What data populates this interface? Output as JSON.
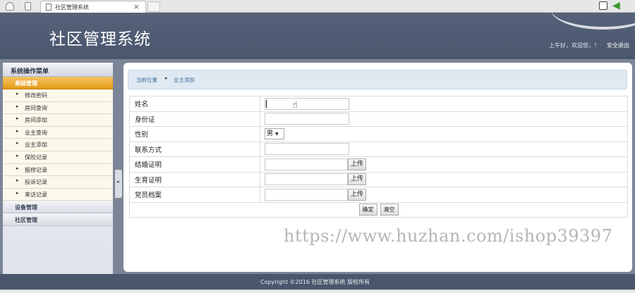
{
  "browser": {
    "tab_title": "社区管理系统",
    "tab_close": "×"
  },
  "header": {
    "brand": "社区管理系统",
    "greeting": "上午好，欢迎您，！",
    "logout": "安全退出"
  },
  "sidebar": {
    "title": "系统操作菜单",
    "groups": [
      {
        "label": "基础管理",
        "items": [
          "修改密码",
          "房间查询",
          "房间添加",
          "业主查询",
          "业主添加",
          "保险记录",
          "报修记录",
          "投诉记录",
          "来访记录"
        ]
      },
      {
        "label": "设备管理"
      },
      {
        "label": "社区管理"
      }
    ],
    "collapse_glyph": "◂"
  },
  "breadcrumb": {
    "current": "当前位置",
    "sep": "▸",
    "page": "业主添加"
  },
  "form": {
    "name_label": "姓名",
    "id_label": "身份证",
    "gender_label": "性别",
    "gender_value": "男",
    "contact_label": "联系方式",
    "marriage_label": "结婚证明",
    "birth_label": "生育证明",
    "party_label": "党员档案",
    "upload_label": "上传",
    "confirm_label": "确定",
    "clear_label": "清空"
  },
  "watermark": "https://www.huzhan.com/ishop39397",
  "footer": {
    "copyright": "Copyright ©2016 社区管理系统 版权所有"
  },
  "colors": {
    "header_bg": "#4a566c",
    "active_group": "#e39a16",
    "crumb_bg": "#dfe9f2"
  }
}
